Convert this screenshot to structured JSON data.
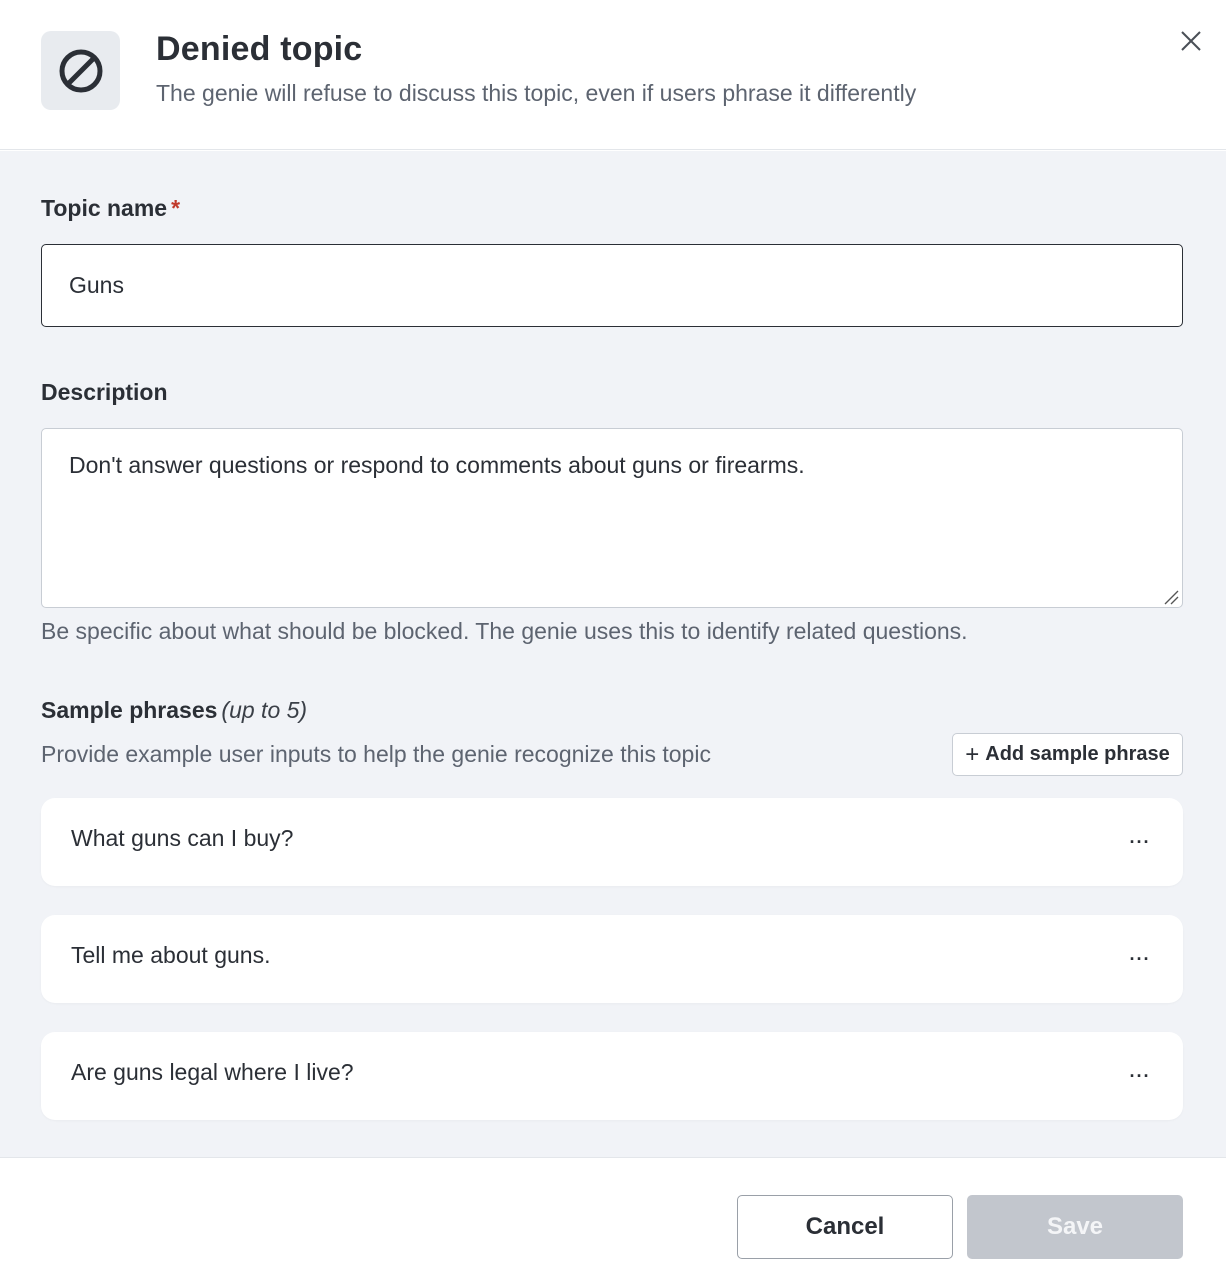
{
  "header": {
    "title": "Denied topic",
    "subtitle": "The genie will refuse to discuss this topic, even if users phrase it differently",
    "icon": "block-icon",
    "close_icon": "close-icon"
  },
  "form": {
    "topic_name": {
      "label": "Topic name",
      "required_mark": "*",
      "value": "Guns"
    },
    "description": {
      "label": "Description",
      "value": "Don't answer questions or respond to comments about guns or firearms.",
      "help": "Be specific about what should be blocked. The genie uses this to identify related questions."
    },
    "sample_phrases": {
      "label": "Sample phrases",
      "label_note": "(up to 5)",
      "help": "Provide example user inputs to help the genie recognize this topic",
      "add_button": "Add sample phrase",
      "add_icon": "+",
      "menu_glyph": "···",
      "items": [
        "What guns can I buy?",
        "Tell me about guns.",
        "Are guns legal where I live?"
      ]
    }
  },
  "footer": {
    "cancel_label": "Cancel",
    "save_label": "Save"
  },
  "colors": {
    "body_background": "#f1f3f7",
    "required": "#c0392b",
    "save_disabled": "#c2c6cd"
  }
}
